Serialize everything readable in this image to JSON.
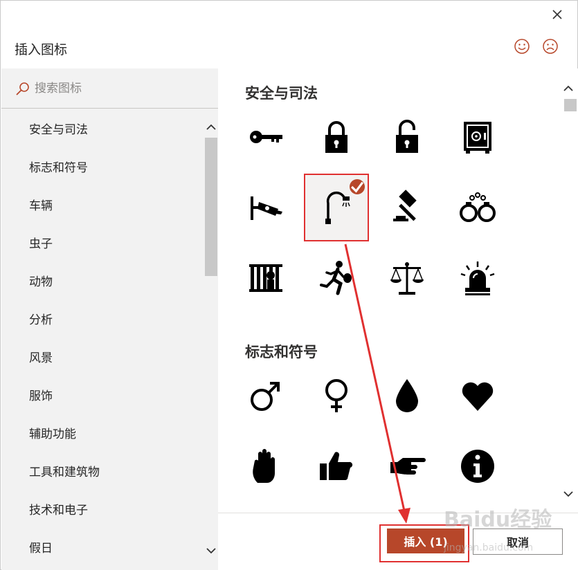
{
  "dialog": {
    "title": "插入图标",
    "close_icon": "close-icon",
    "feedback_positive_icon": "smiley-face-icon",
    "feedback_negative_icon": "sad-face-icon"
  },
  "search": {
    "placeholder": "搜索图标",
    "value": ""
  },
  "sidebar": {
    "items": [
      {
        "label": "安全与司法"
      },
      {
        "label": "标志和符号"
      },
      {
        "label": "车辆"
      },
      {
        "label": "虫子"
      },
      {
        "label": "动物"
      },
      {
        "label": "分析"
      },
      {
        "label": "风景"
      },
      {
        "label": "服饰"
      },
      {
        "label": "辅助功能"
      },
      {
        "label": "工具和建筑物"
      },
      {
        "label": "技术和电子"
      },
      {
        "label": "假日"
      }
    ]
  },
  "sections": [
    {
      "title": "安全与司法",
      "icons": [
        "key-icon",
        "lock-icon",
        "unlock-icon",
        "safe-icon",
        "security-camera-icon",
        "street-light-icon",
        "gavel-icon",
        "handcuffs-icon",
        "jail-icon",
        "running-thief-icon",
        "scales-of-justice-icon",
        "siren-icon"
      ],
      "selected": "street-light-icon"
    },
    {
      "title": "标志和符号",
      "icons": [
        "male-symbol-icon",
        "female-symbol-icon",
        "drop-icon",
        "heart-icon",
        "hand-stop-icon",
        "thumbs-up-icon",
        "pointing-hand-icon",
        "info-icon"
      ]
    }
  ],
  "footer": {
    "insert_label": "插入 (1)",
    "cancel_label": "取消"
  },
  "watermark": {
    "main": "Baidu经验",
    "sub": "jingyan.baidu.com"
  },
  "colors": {
    "accent": "#b7472a",
    "annotation": "#e03030",
    "sidebar_bg": "#f2f2f2"
  }
}
